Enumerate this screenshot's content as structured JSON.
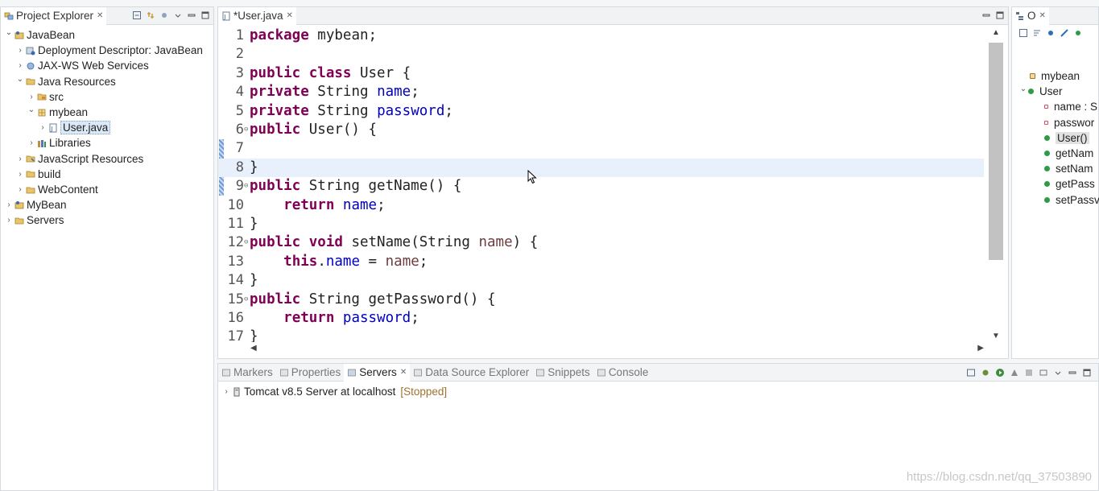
{
  "explorer": {
    "tab_label": "Project Explorer",
    "tree": [
      {
        "label": "JavaBean",
        "depth": 0,
        "expanded": true,
        "icon": "project-icon"
      },
      {
        "label": "Deployment Descriptor: JavaBean",
        "depth": 1,
        "expanded": false,
        "icon": "descriptor-icon"
      },
      {
        "label": "JAX-WS Web Services",
        "depth": 1,
        "expanded": false,
        "icon": "webservice-icon"
      },
      {
        "label": "Java Resources",
        "depth": 1,
        "expanded": true,
        "icon": "folder-icon"
      },
      {
        "label": "src",
        "depth": 2,
        "expanded": false,
        "icon": "source-folder-icon"
      },
      {
        "label": "mybean",
        "depth": 2,
        "expanded": true,
        "icon": "package-icon"
      },
      {
        "label": "User.java",
        "depth": 3,
        "expanded": false,
        "icon": "java-file-icon",
        "selected": true
      },
      {
        "label": "Libraries",
        "depth": 2,
        "expanded": false,
        "icon": "library-icon"
      },
      {
        "label": "JavaScript Resources",
        "depth": 1,
        "expanded": false,
        "icon": "js-resources-icon"
      },
      {
        "label": "build",
        "depth": 1,
        "expanded": false,
        "icon": "folder-icon"
      },
      {
        "label": "WebContent",
        "depth": 1,
        "expanded": false,
        "icon": "folder-icon"
      },
      {
        "label": "MyBean",
        "depth": 0,
        "expanded": false,
        "icon": "project-icon"
      },
      {
        "label": "Servers",
        "depth": 0,
        "expanded": false,
        "icon": "folder-icon"
      }
    ]
  },
  "editor": {
    "tab_label": "*User.java",
    "current_line": 8,
    "lines": [
      {
        "n": "1",
        "tokens": [
          [
            "kw",
            "package"
          ],
          [
            "p",
            " mybean;"
          ]
        ]
      },
      {
        "n": "2",
        "tokens": []
      },
      {
        "n": "3",
        "tokens": [
          [
            "kw",
            "public class"
          ],
          [
            "p",
            " User {"
          ]
        ]
      },
      {
        "n": "4",
        "tokens": [
          [
            "kw",
            "private"
          ],
          [
            "p",
            " String "
          ],
          [
            "fld",
            "name"
          ],
          [
            "p",
            ";"
          ]
        ]
      },
      {
        "n": "5",
        "tokens": [
          [
            "kw",
            "private"
          ],
          [
            "p",
            " String "
          ],
          [
            "fld",
            "password"
          ],
          [
            "p",
            ";"
          ]
        ]
      },
      {
        "n": "6",
        "tokens": [
          [
            "kw",
            "public"
          ],
          [
            "p",
            " User() {"
          ]
        ],
        "fold": true
      },
      {
        "n": "7",
        "tokens": []
      },
      {
        "n": "8",
        "tokens": [
          [
            "p",
            "}"
          ]
        ]
      },
      {
        "n": "9",
        "tokens": [
          [
            "kw",
            "public"
          ],
          [
            "p",
            " String getName() {"
          ]
        ],
        "fold": true
      },
      {
        "n": "10",
        "tokens": [
          [
            "p",
            "    "
          ],
          [
            "kw",
            "return"
          ],
          [
            "p",
            " "
          ],
          [
            "fld",
            "name"
          ],
          [
            "p",
            ";"
          ]
        ]
      },
      {
        "n": "11",
        "tokens": [
          [
            "p",
            "}"
          ]
        ]
      },
      {
        "n": "12",
        "tokens": [
          [
            "kw",
            "public void"
          ],
          [
            "p",
            " setName(String "
          ],
          [
            "par",
            "name"
          ],
          [
            "p",
            ") {"
          ]
        ],
        "fold": true
      },
      {
        "n": "13",
        "tokens": [
          [
            "p",
            "    "
          ],
          [
            "kw",
            "this"
          ],
          [
            "p",
            "."
          ],
          [
            "fld",
            "name"
          ],
          [
            "p",
            " = "
          ],
          [
            "par",
            "name"
          ],
          [
            "p",
            ";"
          ]
        ]
      },
      {
        "n": "14",
        "tokens": [
          [
            "p",
            "}"
          ]
        ]
      },
      {
        "n": "15",
        "tokens": [
          [
            "kw",
            "public"
          ],
          [
            "p",
            " String getPassword() {"
          ]
        ],
        "fold": true
      },
      {
        "n": "16",
        "tokens": [
          [
            "p",
            "    "
          ],
          [
            "kw",
            "return"
          ],
          [
            "p",
            " "
          ],
          [
            "fld",
            "password"
          ],
          [
            "p",
            ";"
          ]
        ]
      },
      {
        "n": "17",
        "tokens": [
          [
            "p",
            "}"
          ]
        ]
      }
    ]
  },
  "outline": {
    "tab_label": "O",
    "items": [
      {
        "label": "mybean",
        "kind": "package",
        "color": "#9a7b2d"
      },
      {
        "label": "User",
        "kind": "class",
        "color": "#2e9b47",
        "expanded": true
      },
      {
        "label": "name : S",
        "kind": "private-field",
        "color": "#d94b6b"
      },
      {
        "label": "passwor",
        "kind": "private-field",
        "color": "#d94b6b"
      },
      {
        "label": "User()",
        "kind": "constructor",
        "color": "#2e9b47",
        "selected": true
      },
      {
        "label": "getNam",
        "kind": "method",
        "color": "#2e9b47"
      },
      {
        "label": "setNam",
        "kind": "method",
        "color": "#2e9b47"
      },
      {
        "label": "getPass",
        "kind": "method",
        "color": "#2e9b47"
      },
      {
        "label": "setPassv",
        "kind": "method",
        "color": "#2e9b47"
      }
    ]
  },
  "bottom": {
    "tabs": [
      {
        "label": "Markers",
        "icon": "markers-icon"
      },
      {
        "label": "Properties",
        "icon": "properties-icon"
      },
      {
        "label": "Servers",
        "icon": "servers-icon",
        "active": true
      },
      {
        "label": "Data Source Explorer",
        "icon": "datasource-icon"
      },
      {
        "label": "Snippets",
        "icon": "snippets-icon"
      },
      {
        "label": "Console",
        "icon": "console-icon"
      }
    ],
    "server": {
      "name": "Tomcat v8.5 Server at localhost",
      "status": "[Stopped]",
      "status_color": "#a0722f"
    }
  },
  "watermark": "https://blog.csdn.net/qq_37503890"
}
